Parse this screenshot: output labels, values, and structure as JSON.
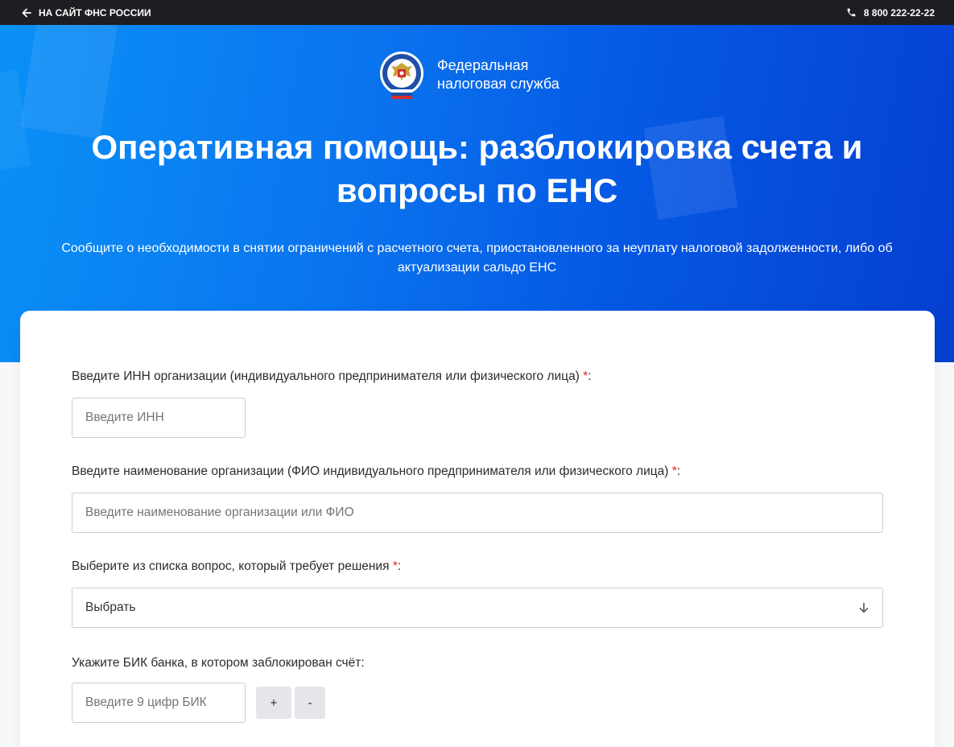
{
  "topbar": {
    "back_label": "НА САЙТ ФНС РОССИИ",
    "phone": "8 800 222-22-22",
    "icons": {
      "back": "arrow-left-icon",
      "phone": "phone-icon"
    }
  },
  "brand": {
    "line1": "Федеральная",
    "line2": "налоговая служба",
    "emblem": "fns-emblem"
  },
  "hero": {
    "title": "Оперативная помощь: разблокировка счета и вопросы по ЕНС",
    "subtitle": "Сообщите о необходимости в снятии ограничений с расчетного счета, приостановленного за неуплату налоговой задолженности, либо об актуализации сальдо ЕНС"
  },
  "form": {
    "inn": {
      "label": "Введите ИНН организации (индивидуального предпринимателя или физического лица)",
      "required_mark": "*",
      "suffix": ":",
      "placeholder": "Введите ИНН"
    },
    "name": {
      "label": "Введите наименование организации (ФИО индивидуального предпринимателя или физического лица)",
      "required_mark": "*",
      "suffix": ":",
      "placeholder": "Введите наименование организации или ФИО"
    },
    "question": {
      "label": "Выберите из списка вопрос, который требует решения",
      "required_mark": "*",
      "suffix": ":",
      "selected": "Выбрать",
      "icon": "arrow-down-icon"
    },
    "bik": {
      "label": "Укажите БИК банка, в котором заблокирован счёт:",
      "placeholder": "Введите 9 цифр БИК",
      "add_label": "+",
      "remove_label": "-"
    }
  },
  "colors": {
    "topbar": "#1d1e22",
    "hero_start": "#0a91f7",
    "hero_end": "#053fd0",
    "required": "#e02020",
    "button_bg": "#e4e6e9"
  }
}
